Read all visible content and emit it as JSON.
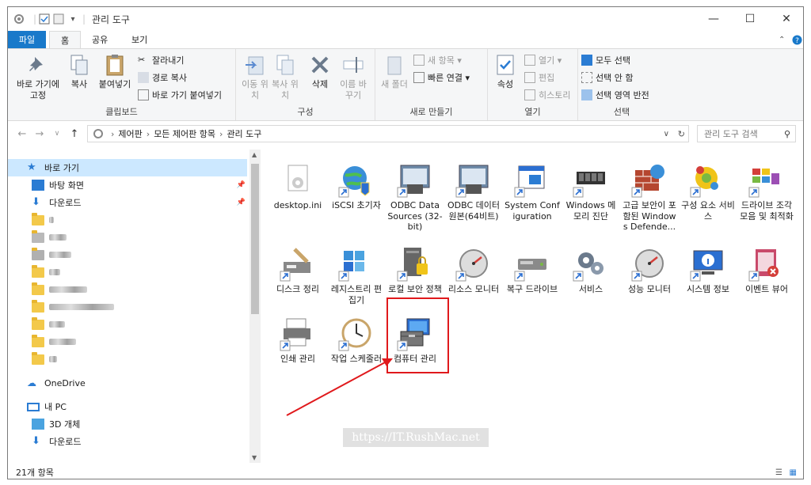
{
  "window": {
    "title": "관리 도구"
  },
  "tabs": [
    {
      "label": "파일"
    },
    {
      "label": "홈"
    },
    {
      "label": "공유"
    },
    {
      "label": "보기"
    }
  ],
  "ribbon": {
    "clipboard": {
      "label": "클립보드",
      "pin": "바로 가기에 고정",
      "copy": "복사",
      "paste": "붙여넣기",
      "cut": "잘라내기",
      "copy_path": "경로 복사",
      "paste_shortcut": "바로 가기 붙여넣기"
    },
    "organize": {
      "label": "구성",
      "move": "이동 위치",
      "copy": "복사 위치",
      "delete": "삭제",
      "rename": "이름 바꾸기"
    },
    "new": {
      "label": "새로 만들기",
      "new_folder": "새 폴더",
      "new_item": "새 항목",
      "easy_access": "빠른 연결"
    },
    "open": {
      "label": "열기",
      "properties": "속성",
      "open": "열기",
      "edit": "편집",
      "history": "히스토리"
    },
    "select": {
      "label": "선택",
      "select_all": "모두 선택",
      "select_none": "선택 안 함",
      "invert": "선택 영역 반전"
    }
  },
  "address": {
    "crumbs": [
      "제어판",
      "모든 제어판 항목",
      "관리 도구"
    ],
    "search_placeholder": "관리 도구 검색"
  },
  "nav": {
    "quick_access": "바로 가기",
    "desktop": "바탕 화면",
    "downloads": "다운로드",
    "onedrive": "OneDrive",
    "this_pc": "내 PC",
    "objects3d": "3D 개체",
    "downloads2": "다운로드"
  },
  "items": [
    {
      "label": "desktop.ini",
      "icon": "ini-file-icon"
    },
    {
      "label": "iSCSI 초기자",
      "icon": "globe-icon"
    },
    {
      "label": "ODBC Data Sources (32-bit)",
      "icon": "odbc-icon"
    },
    {
      "label": "ODBC 데이터 원본(64비트)",
      "icon": "odbc-icon"
    },
    {
      "label": "System Configuration",
      "icon": "sysconfig-icon"
    },
    {
      "label": "Windows 메모리 진단",
      "icon": "memory-icon"
    },
    {
      "label": "고급 보안이 포함된 Windows Defende...",
      "icon": "firewall-icon"
    },
    {
      "label": "구성 요소 서비스",
      "icon": "component-icon"
    },
    {
      "label": "드라이브 조각 모음 및 최적화",
      "icon": "defrag-icon"
    },
    {
      "label": "디스크 정리",
      "icon": "disk-cleanup-icon"
    },
    {
      "label": "레지스트리 편집기",
      "icon": "registry-icon"
    },
    {
      "label": "로컬 보안 정책",
      "icon": "security-policy-icon"
    },
    {
      "label": "리소스 모니터",
      "icon": "gauge-icon"
    },
    {
      "label": "복구 드라이브",
      "icon": "recovery-drive-icon"
    },
    {
      "label": "서비스",
      "icon": "services-gear-icon"
    },
    {
      "label": "성능 모니터",
      "icon": "gauge-icon"
    },
    {
      "label": "시스템 정보",
      "icon": "system-info-icon"
    },
    {
      "label": "이벤트 뷰어",
      "icon": "event-viewer-icon"
    },
    {
      "label": "인쇄 관리",
      "icon": "printer-icon"
    },
    {
      "label": "작업 스케줄러",
      "icon": "clock-icon"
    },
    {
      "label": "컴퓨터 관리",
      "icon": "computer-management-icon"
    }
  ],
  "status": {
    "count": "21개 항목"
  },
  "watermark": "https://IT.RushMac.net",
  "colors": {
    "accent": "#1979ca",
    "selection": "#cce8ff",
    "highlight": "#e0191c"
  }
}
